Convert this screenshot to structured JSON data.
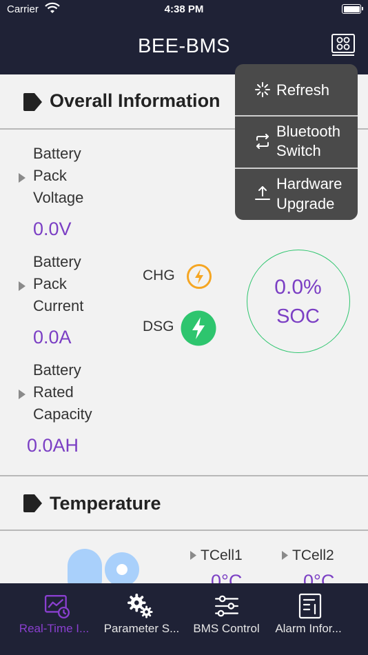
{
  "status_bar": {
    "carrier": "Carrier",
    "time": "4:38 PM"
  },
  "nav": {
    "title": "BEE-BMS"
  },
  "popup_menu": {
    "items": [
      {
        "icon": "refresh-icon",
        "label": "Refresh"
      },
      {
        "icon": "bluetooth-switch-icon",
        "label_line1": "Bluetooth",
        "label_line2": "Switch"
      },
      {
        "icon": "upload-icon",
        "label_line1": "Hardware",
        "label_line2": "Upgrade"
      }
    ]
  },
  "overall": {
    "title": "Overall Information",
    "voltage": {
      "line1": "Battery",
      "line2": "Pack",
      "line3": "Voltage",
      "value": "0.0V"
    },
    "current": {
      "line1": "Battery",
      "line2": "Pack",
      "line3": "Current",
      "value": "0.0A"
    },
    "capacity": {
      "line1": "Battery",
      "line2": "Rated",
      "line3": "Capacity",
      "value": "0.0AH"
    },
    "chg_label": "CHG",
    "dsg_label": "DSG",
    "soc": {
      "percent": "0.0%",
      "label": "SOC"
    },
    "colors": {
      "value": "#7b3fc4",
      "chg": "#f5a623",
      "dsg": "#2ec56e"
    }
  },
  "temperature": {
    "title": "Temperature",
    "tcell1": {
      "label": "TCell1",
      "value": "0°C"
    },
    "tcell2": {
      "label": "TCell2",
      "value": "0°C"
    }
  },
  "tabs": [
    {
      "label": "Real-Time I...",
      "icon": "realtime-chart-icon",
      "active": true
    },
    {
      "label": "Parameter S...",
      "icon": "gears-icon",
      "active": false
    },
    {
      "label": "BMS Control",
      "icon": "sliders-icon",
      "active": false
    },
    {
      "label": "Alarm Infor...",
      "icon": "alarm-report-icon",
      "active": false
    }
  ]
}
